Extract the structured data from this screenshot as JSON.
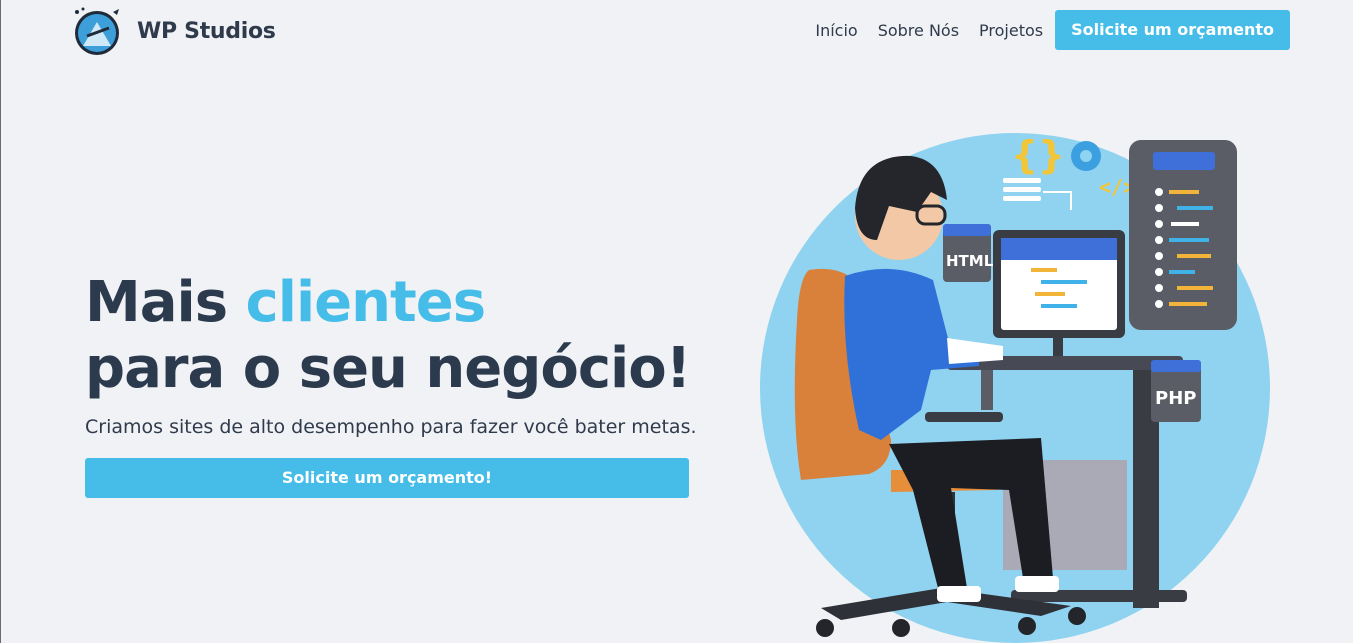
{
  "brand": {
    "name": "WP Studios"
  },
  "nav": {
    "items": [
      {
        "label": "Início"
      },
      {
        "label": "Sobre Nós"
      },
      {
        "label": "Projetos"
      }
    ],
    "cta_label": "Solicite um orçamento"
  },
  "hero": {
    "title_plain": "Mais ",
    "title_accent": "clientes",
    "title_line2": "para o seu negócio!",
    "subtitle": "Criamos sites de alto desempenho para fazer você bater metas.",
    "cta_label": "Solicite um orçamento!"
  },
  "illustration": {
    "html_tag": "HTML",
    "php_tag": "PHP"
  },
  "colors": {
    "accent": "#45bde8",
    "text": "#2c3a4e",
    "background": "#f1f2f5"
  }
}
